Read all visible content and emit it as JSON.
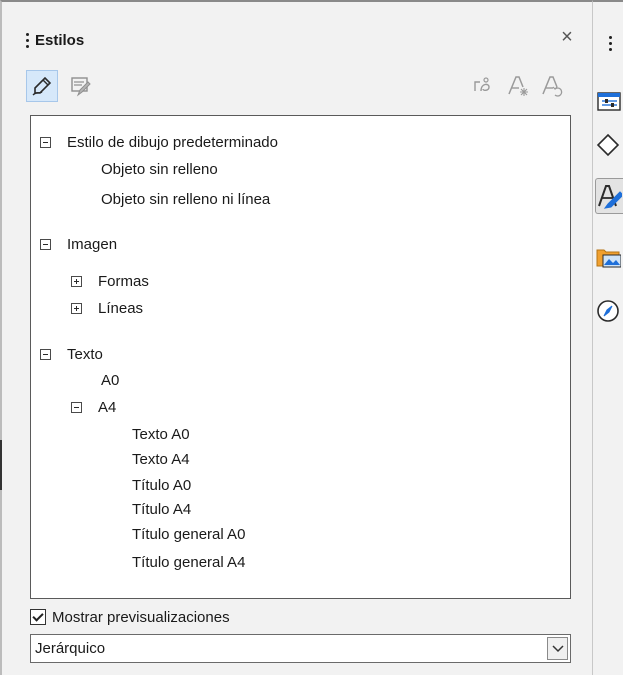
{
  "panel": {
    "title": "Estilos",
    "close_icon": "close-icon"
  },
  "toolbar": {
    "left_icons": [
      "drawing-styles-icon",
      "presentation-styles-icon"
    ],
    "right_icons": [
      "fill-format-mode-icon",
      "new-style-from-selection-icon",
      "update-style-icon"
    ]
  },
  "tree": {
    "default_style": "Estilo de dibujo predeterminado",
    "no_fill": "Objeto sin relleno",
    "no_fill_no_line": "Objeto sin relleno ni línea",
    "imagen": "Imagen",
    "formas": "Formas",
    "lineas": "Líneas",
    "texto": "Texto",
    "a0": "A0",
    "a4": "A4",
    "texto_a0": "Texto A0",
    "texto_a4": "Texto A4",
    "titulo_a0": "Título A0",
    "titulo_a4": "Título A4",
    "titulo_general_a0": "Título general A0",
    "titulo_general_a4": "Título general A4"
  },
  "preview": {
    "label": "Mostrar previsualizaciones",
    "checked": true
  },
  "filter": {
    "selected": "Jerárquico"
  },
  "deck": {
    "icons": [
      "properties-icon",
      "shapes-icon",
      "styles-icon",
      "gallery-icon",
      "navigator-icon"
    ],
    "active": "styles-icon"
  },
  "colors": {
    "accent": "#1e6fd9",
    "active_tool": "#d6e8fa",
    "orange": "#f0a030"
  }
}
